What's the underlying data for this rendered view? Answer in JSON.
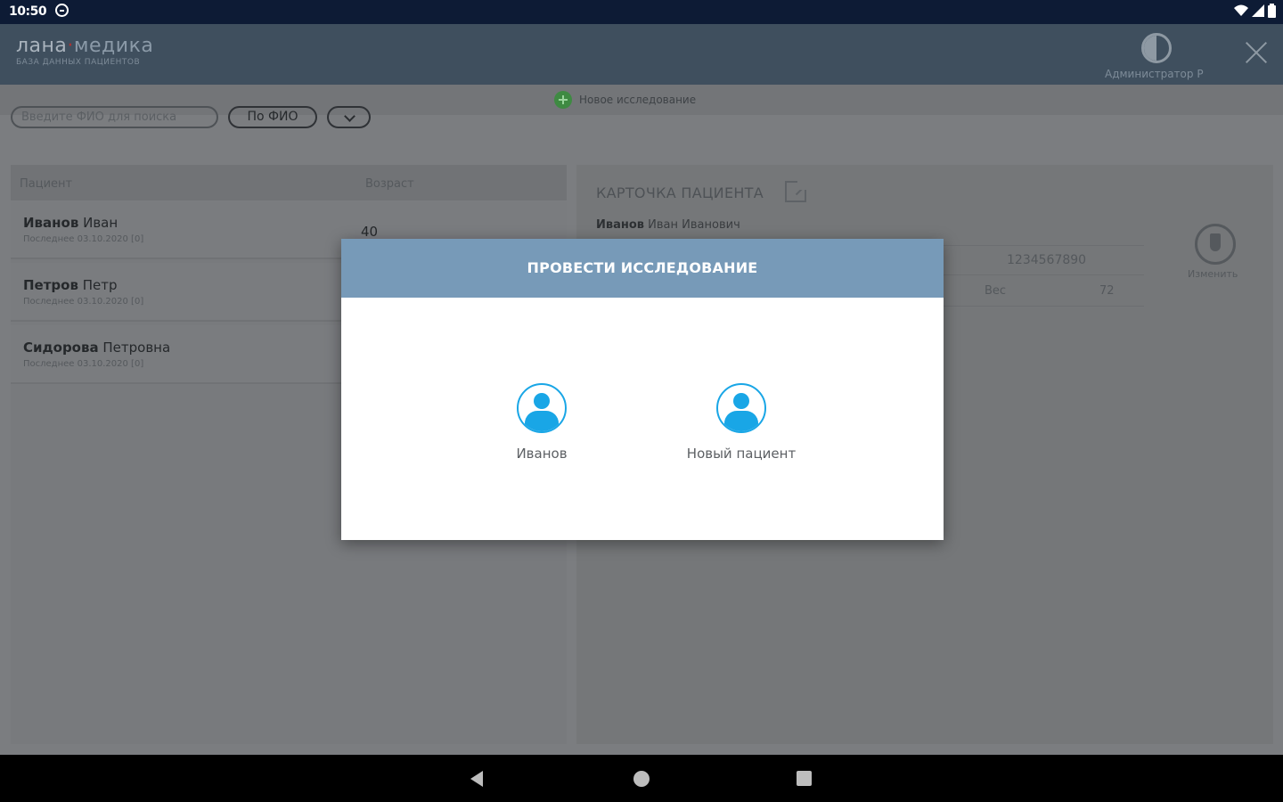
{
  "status_bar": {
    "time": "10:50"
  },
  "header": {
    "logo_first": "лана",
    "logo_dot": "·",
    "logo_second": "медика",
    "logo_subtitle": "БАЗА ДАННЫХ ПАЦИЕНТОВ",
    "user_name": "Администратор Р"
  },
  "new_study": {
    "label": "Новое исследование"
  },
  "search": {
    "placeholder": "Введите ФИО для поиска",
    "filter_label": "По ФИО"
  },
  "patients_table": {
    "headers": {
      "patient": "Пациент",
      "age": "Возраст"
    },
    "rows": [
      {
        "last": "Иванов",
        "first": "Иван",
        "last_visit": "Последнее 03.10.2020 [0]",
        "age": "40"
      },
      {
        "last": "Петров",
        "first": "Петр",
        "last_visit": "Последнее 03.10.2020 [0]",
        "age": ""
      },
      {
        "last": "Сидорова",
        "first": "Петровна",
        "last_visit": "Последнее 03.10.2020 [0]",
        "age": ""
      }
    ]
  },
  "patient_card": {
    "title": "КАРТОЧКА ПАЦИЕНТА",
    "last": "Иванов",
    "rest": "Иван Иванович",
    "phone": "1234567890",
    "weight_label": "Вес",
    "weight_value": "72",
    "edit_label": "Изменить"
  },
  "dialog": {
    "title": "ПРОВЕСТИ ИССЛЕДОВАНИЕ",
    "option_existing": "Иванов",
    "option_new": "Новый пациент"
  },
  "colors": {
    "dialog_header": "#779ab8",
    "avatar_accent": "#19a6e6",
    "app_bar": "#3f4f5e"
  }
}
